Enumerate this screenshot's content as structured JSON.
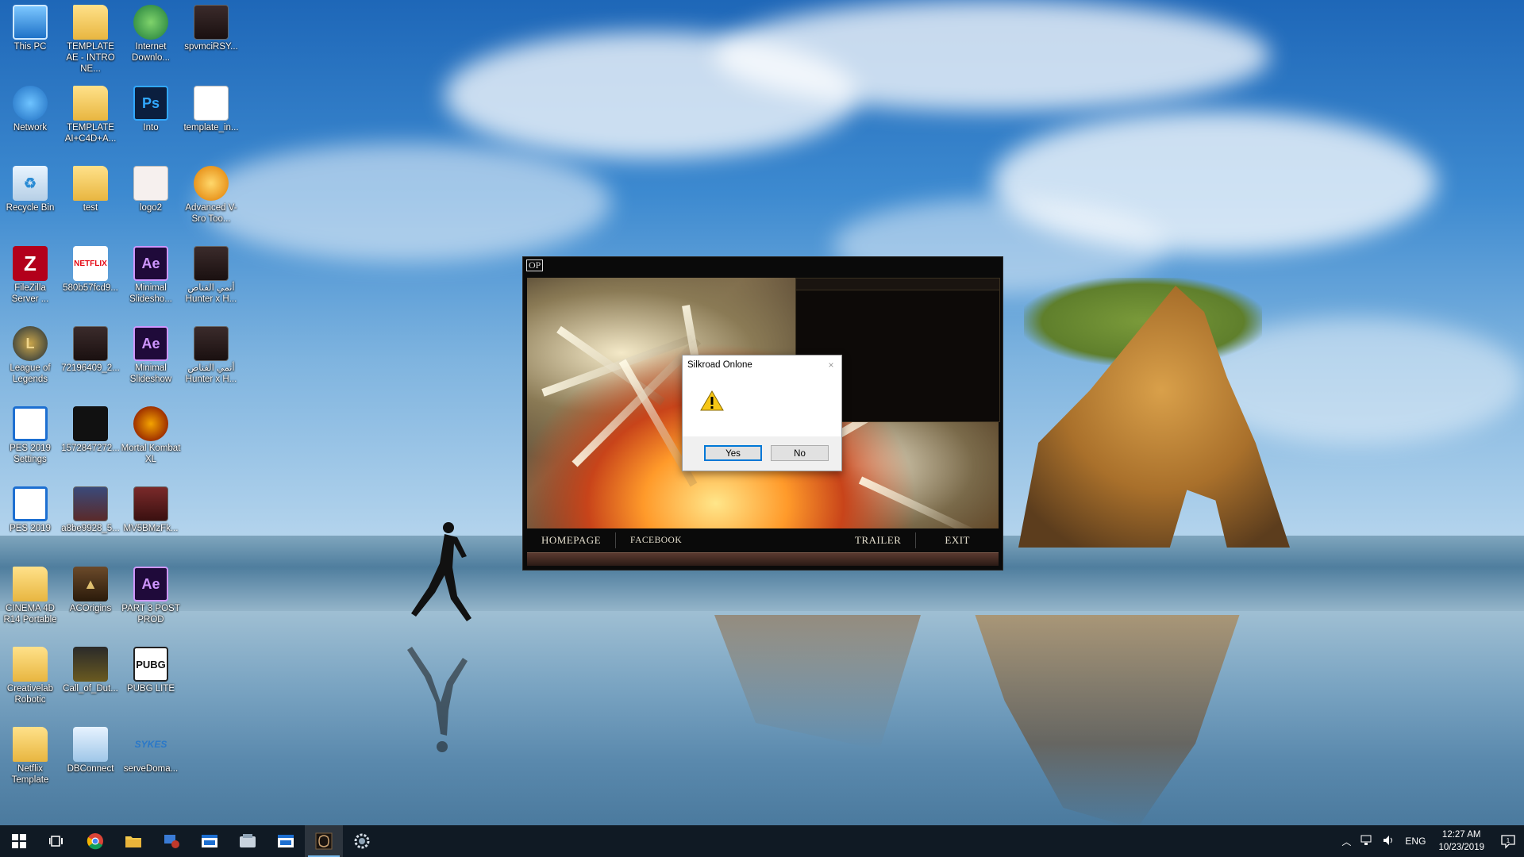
{
  "desktop": {
    "icons": [
      {
        "label": "This PC",
        "icon": "computer-icon"
      },
      {
        "label": "TEMPLATE AE - INTRO NE...",
        "icon": "folder-icon"
      },
      {
        "label": "Internet Downlo...",
        "icon": "internet-download-manager-icon"
      },
      {
        "label": "spvmciRSY...",
        "icon": "movie-poster-icon"
      },
      {
        "label": "Network",
        "icon": "network-icon"
      },
      {
        "label": "TEMPLATE AI+C4D+A...",
        "icon": "folder-icon"
      },
      {
        "label": "Into",
        "icon": "photoshop-file-icon",
        "glyph": "Ps"
      },
      {
        "label": "template_in...",
        "icon": "document-icon"
      },
      {
        "label": "Recycle Bin",
        "icon": "recycle-bin-icon"
      },
      {
        "label": "test",
        "icon": "folder-icon"
      },
      {
        "label": "logo2",
        "icon": "image-file-icon"
      },
      {
        "label": "Advanced V-Sro Too...",
        "icon": "naruto-app-icon"
      },
      {
        "label": "FileZilla Server ...",
        "icon": "filezilla-icon",
        "glyph": "Z"
      },
      {
        "label": "580b57fcd9...",
        "icon": "netflix-logo-icon",
        "glyph": "NETFLIX"
      },
      {
        "label": "Minimal Slidesho...",
        "icon": "after-effects-file-icon",
        "glyph": "Ae"
      },
      {
        "label": "أنمي القناص Hunter x H...",
        "icon": "video-file-icon"
      },
      {
        "label": "League of Legends",
        "icon": "league-of-legends-icon"
      },
      {
        "label": "72196409_2...",
        "icon": "image-file-icon"
      },
      {
        "label": "Minimal Slideshow",
        "icon": "after-effects-file-icon",
        "glyph": "Ae"
      },
      {
        "label": "أنمي القناص Hunter x H...",
        "icon": "video-file-icon"
      },
      {
        "label": "PES 2019 Settings",
        "icon": "pes-settings-icon"
      },
      {
        "label": "1572847272...",
        "icon": "black-image-icon"
      },
      {
        "label": "Mortal Kombat XL",
        "icon": "mortal-kombat-icon"
      },
      {
        "label": "PES 2019",
        "icon": "pes-icon"
      },
      {
        "label": "a8be9928_5...",
        "icon": "image-file-icon"
      },
      {
        "label": "MV5BMzFk...",
        "icon": "image-file-icon"
      },
      {
        "label": "CINEMA 4D R14 Portable",
        "icon": "folder-icon"
      },
      {
        "label": "ACOrigins",
        "icon": "assassins-creed-icon"
      },
      {
        "label": "PART 3 POST PROD",
        "icon": "after-effects-file-icon",
        "glyph": "Ae"
      },
      {
        "label": "Creativelab Robotic",
        "icon": "folder-icon"
      },
      {
        "label": "Call_of_Dut...",
        "icon": "call-of-duty-icon"
      },
      {
        "label": "PUBG LITE",
        "icon": "pubg-icon",
        "glyph": "PUBG"
      },
      {
        "label": "Netflix Template",
        "icon": "folder-icon"
      },
      {
        "label": "DBConnect",
        "icon": "db-connect-icon"
      },
      {
        "label": "serveDoma...",
        "icon": "sykes-icon",
        "glyph": "SYKES"
      }
    ]
  },
  "launcher": {
    "logo": "OP",
    "nav": {
      "homepage": "HOMEPAGE",
      "facebook": "FACEBOOK",
      "trailer": "TRAILER",
      "exit": "EXIT"
    }
  },
  "dialog": {
    "title": "Silkroad Onlone",
    "close_glyph": "×",
    "yes_label": "Yes",
    "no_label": "No"
  },
  "taskbar": {
    "apps": [
      {
        "name": "start-button",
        "icon": "windows-icon"
      },
      {
        "name": "task-view-button",
        "icon": "task-view-icon"
      },
      {
        "name": "chrome-button",
        "icon": "chrome-icon"
      },
      {
        "name": "file-explorer-button",
        "icon": "folder-icon"
      },
      {
        "name": "app-button-1",
        "icon": "network-app-icon"
      },
      {
        "name": "app-button-2",
        "icon": "window-app-icon"
      },
      {
        "name": "app-button-3",
        "icon": "tool-app-icon"
      },
      {
        "name": "app-button-4",
        "icon": "window-app-icon"
      },
      {
        "name": "silkroad-launcher-button",
        "icon": "silkroad-icon",
        "active": true
      },
      {
        "name": "app-button-5",
        "icon": "gear-app-icon"
      }
    ],
    "tray": {
      "language": "ENG",
      "time": "12:27 AM",
      "date": "10/23/2019",
      "notification_count": "1"
    }
  }
}
